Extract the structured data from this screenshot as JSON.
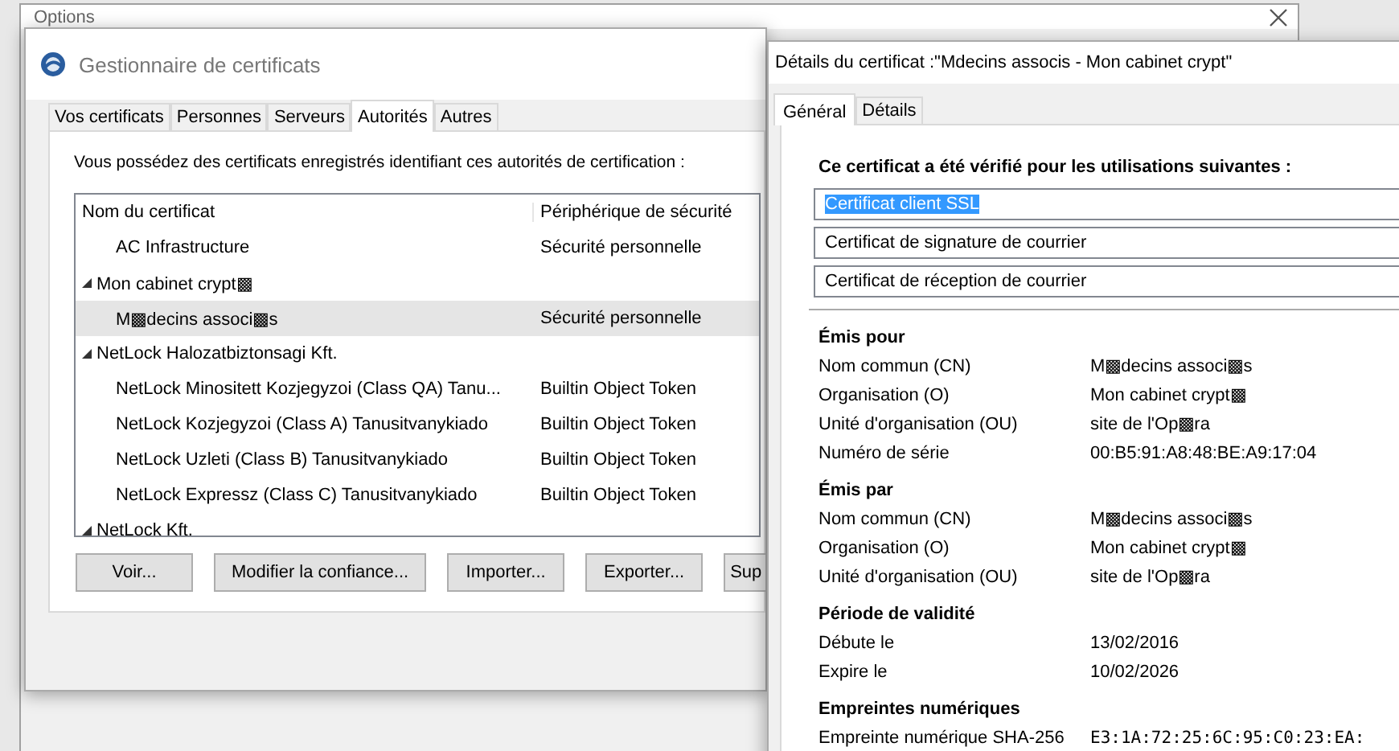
{
  "background_window": {
    "title": "Options"
  },
  "certificate_manager": {
    "title": "Gestionnaire de certificats",
    "tabs": [
      {
        "label": "Vos certificats",
        "selected": false
      },
      {
        "label": "Personnes",
        "selected": false
      },
      {
        "label": "Serveurs",
        "selected": false
      },
      {
        "label": "Autorités",
        "selected": true
      },
      {
        "label": "Autres",
        "selected": false
      }
    ],
    "intro": "Vous possédez des certificats enregistrés identifiant ces autorités de certification :",
    "columns": [
      "Nom du certificat",
      "Périphérique de sécurité"
    ],
    "tree": [
      {
        "children": [
          {
            "name": "AC Infrastructure",
            "device": "Sécurité personnelle",
            "selected": false
          }
        ]
      },
      {
        "name": "Mon cabinet crypt▩",
        "expanded": true,
        "selected": false,
        "children": [
          {
            "name": "M▩decins associ▩s",
            "device": "Sécurité personnelle",
            "selected": true
          }
        ]
      },
      {
        "name": "NetLock Halozatbiztonsagi Kft.",
        "expanded": true,
        "selected": false,
        "children": [
          {
            "name": "NetLock Minositett Kozjegyzoi (Class QA) Tanu...",
            "device": "Builtin Object Token",
            "selected": false
          },
          {
            "name": "NetLock Kozjegyzoi (Class A) Tanusitvanykiado",
            "device": "Builtin Object Token",
            "selected": false
          },
          {
            "name": "NetLock Uzleti (Class B) Tanusitvanykiado",
            "device": "Builtin Object Token",
            "selected": false
          },
          {
            "name": "NetLock Expressz (Class C) Tanusitvanykiado",
            "device": "Builtin Object Token",
            "selected": false
          }
        ]
      },
      {
        "name": "NetLock Kft.",
        "expanded": true,
        "selected": false
      }
    ],
    "buttons": [
      "Voir...",
      "Modifier la confiance...",
      "Importer...",
      "Exporter...",
      "Sup"
    ]
  },
  "certificate_details": {
    "title": "Détails du certificat :\"Mdecins associs - Mon cabinet crypt\"",
    "tabs": [
      {
        "label": "Général",
        "selected": true
      },
      {
        "label": "Détails",
        "selected": false
      }
    ],
    "usages_heading": "Ce certificat a été vérifié pour les utilisations suivantes :",
    "usages": [
      {
        "text": "Certificat client SSL",
        "selected": true
      },
      {
        "text": "Certificat de signature de courrier",
        "selected": false
      },
      {
        "text": "Certificat de réception de courrier",
        "selected": false
      }
    ],
    "sections": [
      {
        "heading": "Émis pour",
        "rows": [
          {
            "kind": "text",
            "label": "Nom commun (CN)",
            "value": "M▩decins associ▩s"
          },
          {
            "kind": "text",
            "label": "Organisation (O)",
            "value": "Mon cabinet crypt▩"
          },
          {
            "kind": "text",
            "label": "Unité d'organisation (OU)",
            "value": "site de l'Op▩ra"
          },
          {
            "kind": "text",
            "label": "Numéro de série",
            "value": "00:B5:91:A8:48:BE:A9:17:04"
          }
        ]
      },
      {
        "heading": "Émis par",
        "rows": [
          {
            "kind": "text",
            "label": "Nom commun (CN)",
            "value": "M▩decins associ▩s"
          },
          {
            "kind": "text",
            "label": "Organisation (O)",
            "value": "Mon cabinet crypt▩"
          },
          {
            "kind": "text",
            "label": "Unité d'organisation (OU)",
            "value": "site de l'Op▩ra"
          }
        ]
      },
      {
        "heading": "Période de validité",
        "rows": [
          {
            "kind": "text",
            "label": "Débute le",
            "value": "13/02/2016"
          },
          {
            "kind": "text",
            "label": "Expire le",
            "value": "10/02/2026"
          }
        ]
      },
      {
        "heading": "Empreintes numériques",
        "rows": [
          {
            "kind": "fingerprint",
            "label": "Empreinte numérique SHA-256",
            "value": "E3:1A:72:25:6C:95:C0:23:EA:"
          }
        ]
      }
    ]
  }
}
